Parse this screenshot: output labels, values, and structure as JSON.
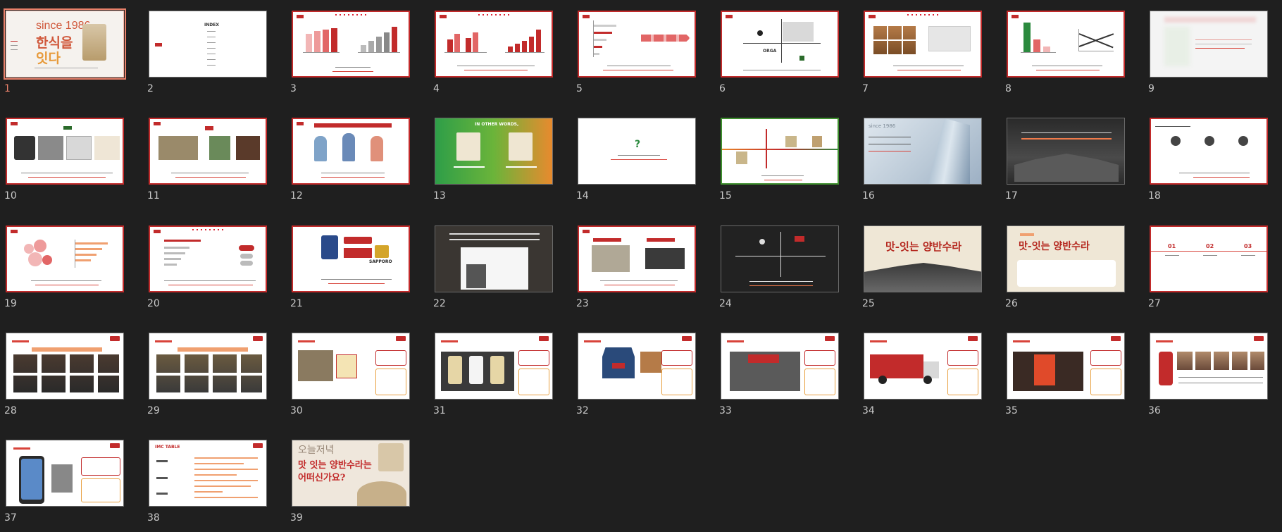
{
  "colors": {
    "background": "#1f1f1f",
    "selection": "#e8806a",
    "accent": "#c22b2b",
    "label": "#c8c8c8"
  },
  "slides": [
    {
      "number": "1",
      "selected": true,
      "text": [
        "since 1986",
        "한식을",
        "잇다"
      ]
    },
    {
      "number": "2",
      "text": [
        "INDEX"
      ]
    },
    {
      "number": "3",
      "text": []
    },
    {
      "number": "4",
      "text": []
    },
    {
      "number": "5",
      "text": []
    },
    {
      "number": "6",
      "text": [
        "ORGA"
      ]
    },
    {
      "number": "7",
      "text": []
    },
    {
      "number": "8",
      "text": []
    },
    {
      "number": "9",
      "text": []
    },
    {
      "number": "10",
      "text": []
    },
    {
      "number": "11",
      "text": []
    },
    {
      "number": "12",
      "text": []
    },
    {
      "number": "13",
      "text": [
        "IN OTHER WORDS,"
      ]
    },
    {
      "number": "14",
      "text": [
        "?"
      ]
    },
    {
      "number": "15",
      "text": []
    },
    {
      "number": "16",
      "text": [
        "since 1986"
      ]
    },
    {
      "number": "17",
      "text": []
    },
    {
      "number": "18",
      "text": []
    },
    {
      "number": "19",
      "text": []
    },
    {
      "number": "20",
      "text": []
    },
    {
      "number": "21",
      "text": [
        "SAPPORO"
      ]
    },
    {
      "number": "22",
      "text": []
    },
    {
      "number": "23",
      "text": []
    },
    {
      "number": "24",
      "text": []
    },
    {
      "number": "25",
      "text": [
        "맛-잇는 양반수라"
      ]
    },
    {
      "number": "26",
      "text": [
        "맛-잇는 양반수라"
      ]
    },
    {
      "number": "27",
      "text": [
        "01",
        "02",
        "03"
      ]
    },
    {
      "number": "28",
      "text": []
    },
    {
      "number": "29",
      "text": []
    },
    {
      "number": "30",
      "text": []
    },
    {
      "number": "31",
      "text": []
    },
    {
      "number": "32",
      "text": []
    },
    {
      "number": "33",
      "text": []
    },
    {
      "number": "34",
      "text": []
    },
    {
      "number": "35",
      "text": []
    },
    {
      "number": "36",
      "text": []
    },
    {
      "number": "37",
      "text": []
    },
    {
      "number": "38",
      "text": [
        "IMC TABLE"
      ]
    },
    {
      "number": "39",
      "text": [
        "오늘저녁",
        "맛 잇는 양반수라는",
        "어떠신가요?"
      ]
    }
  ]
}
